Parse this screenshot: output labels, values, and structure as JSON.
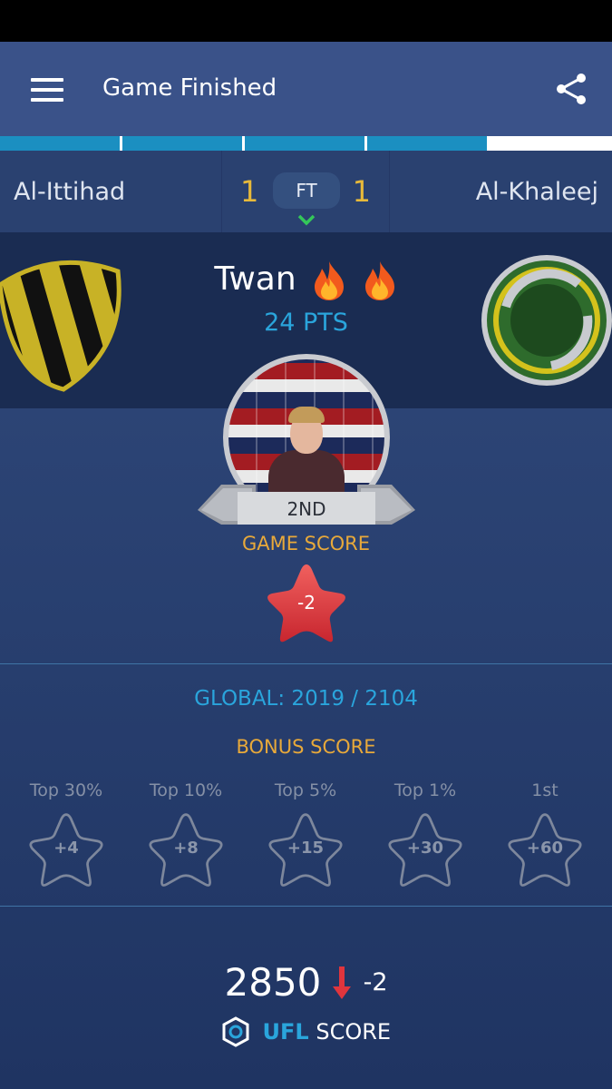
{
  "header": {
    "title": "Game Finished",
    "menu_icon": "hamburger-menu-icon",
    "share_icon": "share-icon"
  },
  "progress": {
    "segments_filled": 4,
    "segments_total": 5,
    "fill_color": "#1b8fc1"
  },
  "match": {
    "home_team": "Al-Ittihad",
    "away_team": "Al-Khaleej",
    "home_score": "1",
    "away_score": "1",
    "status": "FT"
  },
  "player": {
    "name": "Twan",
    "points": "24 PTS",
    "rank": "2ND"
  },
  "game_score": {
    "label": "GAME SCORE",
    "value": "-2"
  },
  "global": "GLOBAL: 2019 / 2104",
  "bonus": {
    "label": "BONUS SCORE",
    "items": [
      {
        "label": "Top 30%",
        "value": "+4"
      },
      {
        "label": "Top 10%",
        "value": "+8"
      },
      {
        "label": "Top 5%",
        "value": "+15"
      },
      {
        "label": "Top 1%",
        "value": "+30"
      },
      {
        "label": "1st",
        "value": "+60"
      }
    ]
  },
  "ufl": {
    "total": "2850",
    "delta": "-2",
    "brand": "UFL",
    "score_word": "SCORE"
  },
  "colors": {
    "accent_blue": "#2aa5dc",
    "accent_gold": "#e8a93a",
    "score_gold": "#e7b93a",
    "star_red": "#e0353d"
  }
}
